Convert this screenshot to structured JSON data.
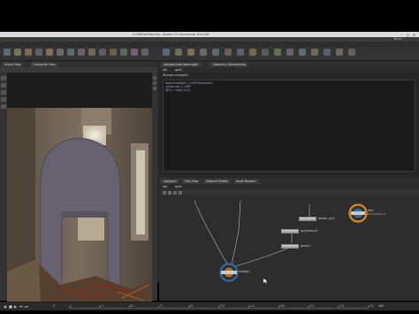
{
  "window": {
    "title": "C:/TMP/Untitled.hip - Houdini FX Commercial 19.0.536",
    "controls": [
      "–",
      "□",
      "✕"
    ]
  },
  "menubar": {
    "items": [
      "File",
      "Edit",
      "Render",
      "Assets",
      "Windows",
      "Help"
    ],
    "desktop": "Build"
  },
  "shelf_tabs": [
    "Create",
    "Modify",
    "Model",
    "Polygon",
    "Deform",
    "Texture",
    "Rigging",
    "Characters",
    "Constraints",
    "Hair Utils",
    "Guide Process",
    "Terrain FX"
  ],
  "viewport": {
    "tabs": [
      "Scene View",
      "Composite View"
    ],
    "colors": {
      "wall": "#6f6660",
      "arch": "#65606e",
      "rubble": "#5a3c2c"
    }
  },
  "params": {
    "tabs": [
      "/obj/geo1/attribwrangle1",
      "Geometry Spreadsheet"
    ],
    "crumbs": [
      "obj",
      "geo1"
    ],
    "header": "Wrangle  wrangle1",
    "code_lines": [
      "float threshold = chf(\"threshold\");",
      "vector pos = v@P;",
      "@Cd = set(1,0,0);"
    ]
  },
  "network": {
    "tabs": [
      "/obj/geo1",
      "Tree View",
      "Material Palette",
      "Asset Browser"
    ],
    "crumbs": [
      "obj",
      "geo1"
    ],
    "nodes": [
      {
        "name": "file1",
        "sub": "Intro.bgeo.sc"
      },
      {
        "name": "delete_arch",
        "sub": ""
      },
      {
        "name": "polyreduce1",
        "sub": ""
      },
      {
        "name": "group1",
        "sub": ""
      },
      {
        "name": "merge1",
        "sub": ""
      }
    ],
    "accent": "#e08a1e"
  },
  "timeline": {
    "ticks": [
      "1",
      "24",
      "48",
      "72",
      "96",
      "120",
      "144",
      "168",
      "192",
      "216",
      "240"
    ],
    "current_frame": "1",
    "end_frame": "240"
  }
}
